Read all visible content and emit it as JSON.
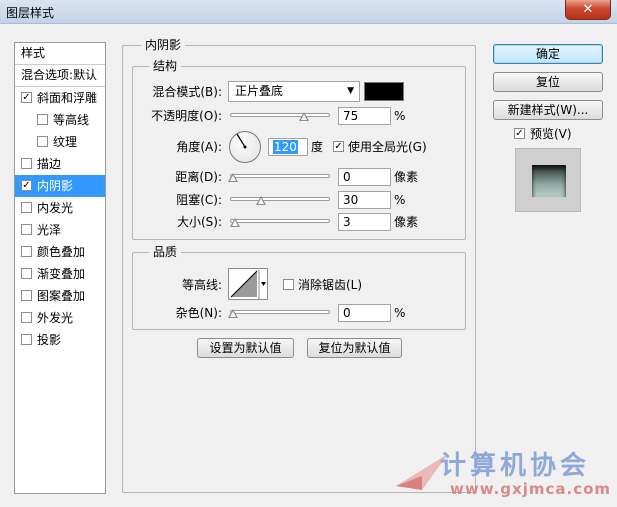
{
  "window": {
    "title": "图层样式",
    "close_glyph": "✕"
  },
  "stylelist": {
    "header": "样式",
    "blend_options": "混合选项:默认",
    "items": [
      {
        "label": "斜面和浮雕",
        "checked": true,
        "indent": false,
        "selected": false
      },
      {
        "label": "等高线",
        "checked": false,
        "indent": true,
        "selected": false
      },
      {
        "label": "纹理",
        "checked": false,
        "indent": true,
        "selected": false
      },
      {
        "label": "描边",
        "checked": false,
        "indent": false,
        "selected": false
      },
      {
        "label": "内阴影",
        "checked": true,
        "indent": false,
        "selected": true
      },
      {
        "label": "内发光",
        "checked": false,
        "indent": false,
        "selected": false
      },
      {
        "label": "光泽",
        "checked": false,
        "indent": false,
        "selected": false
      },
      {
        "label": "颜色叠加",
        "checked": false,
        "indent": false,
        "selected": false
      },
      {
        "label": "渐变叠加",
        "checked": false,
        "indent": false,
        "selected": false
      },
      {
        "label": "图案叠加",
        "checked": false,
        "indent": false,
        "selected": false
      },
      {
        "label": "外发光",
        "checked": false,
        "indent": false,
        "selected": false
      },
      {
        "label": "投影",
        "checked": false,
        "indent": false,
        "selected": false
      }
    ]
  },
  "panel": {
    "title": "内阴影",
    "structure": {
      "title": "结构",
      "blend_mode_label": "混合模式(B):",
      "blend_mode_value": "正片叠底",
      "blend_color": "#000000",
      "opacity_label": "不透明度(O):",
      "opacity_value": "75",
      "opacity_unit": "%",
      "angle_label": "角度(A):",
      "angle_value": "120",
      "angle_unit": "度",
      "global_light_label": "使用全局光(G)",
      "global_light_checked": true,
      "distance_label": "距离(D):",
      "distance_value": "0",
      "distance_unit": "像素",
      "choke_label": "阻塞(C):",
      "choke_value": "30",
      "choke_unit": "%",
      "size_label": "大小(S):",
      "size_value": "3",
      "size_unit": "像素"
    },
    "quality": {
      "title": "品质",
      "contour_label": "等高线:",
      "antialias_label": "消除锯齿(L)",
      "antialias_checked": false,
      "noise_label": "杂色(N):",
      "noise_value": "0",
      "noise_unit": "%"
    },
    "make_default": "设置为默认值",
    "reset_default": "复位为默认值"
  },
  "buttons": {
    "ok": "确定",
    "reset": "复位",
    "new_style": "新建样式(W)...",
    "preview_label": "预览(V)",
    "preview_checked": true
  },
  "watermark": {
    "cn": "计算机协会",
    "url": "www.gxjmca.com"
  }
}
